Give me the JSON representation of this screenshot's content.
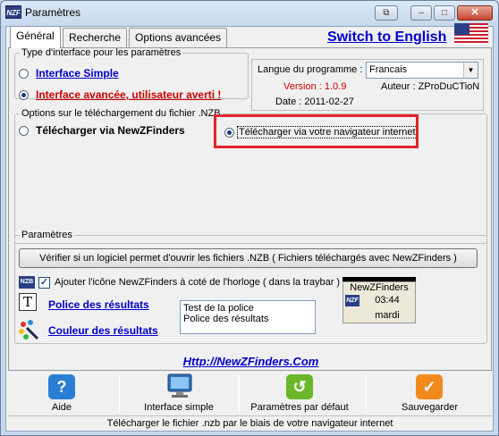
{
  "window": {
    "title": "Paramètres",
    "logo_text": "NZF",
    "buttons": {
      "restore_label": "⧉",
      "minimize_label": "–",
      "maximize_label": "□",
      "close_label": "✕"
    }
  },
  "tabs": [
    {
      "label": "Général",
      "active": true
    },
    {
      "label": "Recherche",
      "active": false
    },
    {
      "label": "Options avancées",
      "active": false
    }
  ],
  "switch_language": {
    "label": "Switch to English",
    "flag_icon": "us-flag-icon"
  },
  "interface_group": {
    "legend": "Type d'interface pour les paramètres",
    "options": [
      {
        "label": "Interface Simple",
        "selected": false
      },
      {
        "label": "Interface avancée, utilisateur averti !",
        "selected": true
      }
    ]
  },
  "language_box": {
    "label": "Langue du programme :",
    "selected": "Francais",
    "version": "Version : 1.0.9",
    "author": "Auteur : ZProDuCTioN",
    "date": "Date : 2011-02-27"
  },
  "download_group": {
    "legend": "Options sur le téléchargement du fichier .NZB",
    "options": [
      {
        "label": "Télécharger via NewZFinders",
        "selected": false
      },
      {
        "label": "Télécharger via votre navigateur internet",
        "selected": true
      }
    ]
  },
  "params_group": {
    "legend": "Paramètres",
    "check_button_label": "Vérifier si un logiciel permet d'ouvrir les fichiers .NZB ( Fichiers téléchargés avec NewZFinders )",
    "tray_checkbox": {
      "label": "Ajouter l'icône NewZFinders à coté de l'horloge ( dans la traybar )",
      "checked": true,
      "icon_text": "NZB"
    },
    "font_link": "Police des résultats",
    "color_link": "Couleur des résultats",
    "font_icon_text": "T",
    "preview_lines": [
      "Test de la police",
      "Police des résultats"
    ],
    "clock": {
      "title": "NewZFinders",
      "logo_text": "NZF",
      "time": "03:44",
      "day": "mardi"
    }
  },
  "website": "Http://NewZFinders.Com",
  "bottom_buttons": [
    {
      "label": "Aide",
      "icon": "help-icon",
      "glyph": "?",
      "color": "#2a7fd4"
    },
    {
      "label": "Interface simple",
      "icon": "monitor-icon",
      "glyph": "",
      "color": "#4a8ad0"
    },
    {
      "label": "Paramètres par défaut",
      "icon": "reset-icon",
      "glyph": "↺",
      "color": "#6ab82a"
    },
    {
      "label": "Sauvegarder",
      "icon": "save-check-icon",
      "glyph": "✓",
      "color": "#f08a1c"
    }
  ],
  "status_text": "Télécharger le fichier .nzb par le biais de votre navigateur internet",
  "colors": {
    "link_blue": "#0000cc",
    "link_red": "#cc0000",
    "version_red": "#cc0000",
    "highlight": "#e3242b"
  }
}
